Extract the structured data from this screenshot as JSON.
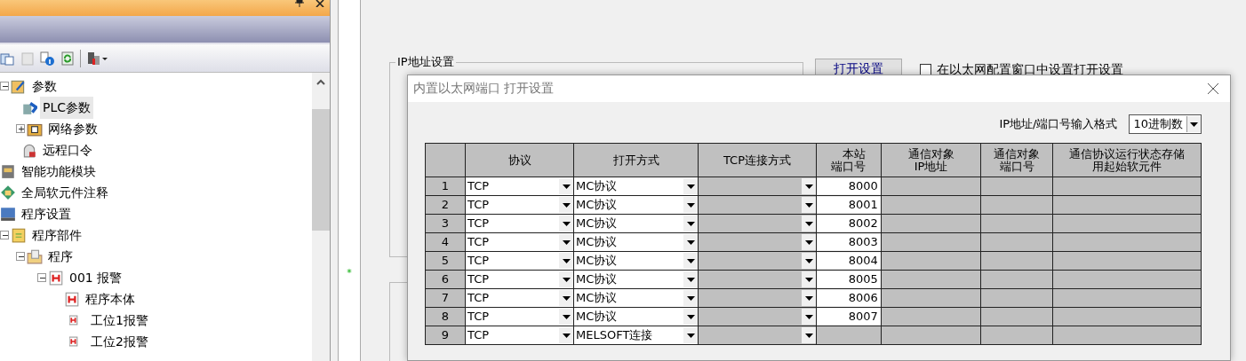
{
  "tree": [
    {
      "label": "参数",
      "kind": "params",
      "expanded": true,
      "selected": false,
      "children": [
        {
          "label": "PLC参数",
          "kind": "plc",
          "selected": true
        },
        {
          "label": "网络参数",
          "kind": "network",
          "expanded": false,
          "selected": false
        },
        {
          "label": "远程口令",
          "kind": "lock",
          "selected": false
        }
      ]
    },
    {
      "label": "智能功能模块",
      "kind": "module",
      "selected": false
    },
    {
      "label": "全局软元件注释",
      "kind": "comment",
      "selected": false
    },
    {
      "label": "程序设置",
      "kind": "setting",
      "selected": false
    },
    {
      "label": "程序部件",
      "kind": "parts",
      "expanded": true,
      "selected": false,
      "children": [
        {
          "label": "程序",
          "kind": "folder",
          "expanded": true,
          "selected": false,
          "children": [
            {
              "label": "001 报警",
              "kind": "program",
              "expanded": true,
              "selected": false,
              "children": [
                {
                  "label": "程序本体",
                  "kind": "program",
                  "selected": false
                },
                {
                  "label": "工位1报警",
                  "kind": "small",
                  "selected": false
                },
                {
                  "label": "工位2报警",
                  "kind": "small",
                  "selected": false
                }
              ]
            }
          ]
        }
      ]
    }
  ],
  "main": {
    "ip_group": {
      "title": "IP地址设置"
    },
    "open_settings_button": "打开设置",
    "config_checkbox": {
      "label": "在以太网配置窗口中设置打开设置",
      "checked": false
    },
    "star_mark": "*"
  },
  "dialog": {
    "title": "内置以太网端口 打开设置",
    "format_label": "IP地址/端口号输入格式",
    "format_value": "10进制数",
    "table": {
      "columns": [
        "协议",
        "打开方式",
        "TCP连接方式",
        "本站端口号",
        "通信对象IP地址",
        "通信对象端口号",
        "通信协议运行状态存储用起始软元件"
      ],
      "rows": [
        {
          "no": "1",
          "protocol": "TCP",
          "open_method": "MC协议",
          "port": "8000"
        },
        {
          "no": "2",
          "protocol": "TCP",
          "open_method": "MC协议",
          "port": "8001"
        },
        {
          "no": "3",
          "protocol": "TCP",
          "open_method": "MC协议",
          "port": "8002"
        },
        {
          "no": "4",
          "protocol": "TCP",
          "open_method": "MC协议",
          "port": "8003"
        },
        {
          "no": "5",
          "protocol": "TCP",
          "open_method": "MC协议",
          "port": "8004"
        },
        {
          "no": "6",
          "protocol": "TCP",
          "open_method": "MC协议",
          "port": "8005"
        },
        {
          "no": "7",
          "protocol": "TCP",
          "open_method": "MC协议",
          "port": "8006"
        },
        {
          "no": "8",
          "protocol": "TCP",
          "open_method": "MC协议",
          "port": "8007"
        },
        {
          "no": "9",
          "protocol": "TCP",
          "open_method": "MELSOFT连接"
        }
      ]
    }
  }
}
